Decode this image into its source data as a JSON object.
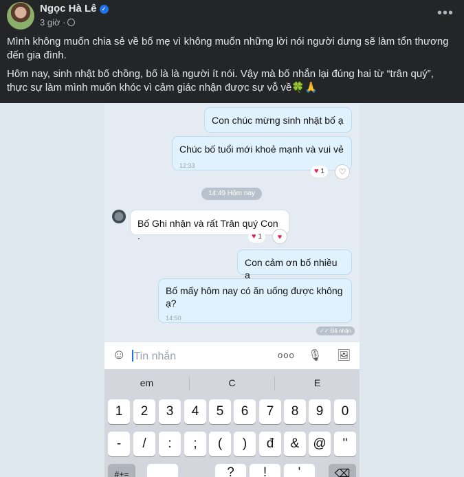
{
  "post": {
    "author": "Ngọc Hà Lê",
    "verified_glyph": "✓",
    "time": "3 giờ ·",
    "more_label": "•••",
    "paragraphs": [
      "Mình không muốn chia sẻ về bố mẹ vì không muốn những lời nói người dưng sẽ làm tổn thương đến gia đình.",
      "Hôm nay, sinh nhật bố chồng, bố là là người ít nói. Vậy mà bố nhắn lại đúng hai từ “trân quý”, thực sự làm mình muốn khóc vì cảm giác nhận được sự vỗ về🍀🙏"
    ]
  },
  "chat": {
    "messages": [
      {
        "text": "Con chúc mừng sinh nhật bố ạ",
        "direction": "out"
      },
      {
        "text": "Chúc bố tuổi mới khoẻ mạnh và vui vẻ",
        "time": "12:33",
        "direction": "out",
        "reaction_count": "1"
      },
      {
        "text": "Bố Ghi nhận và rất Trân quý Con .",
        "direction": "in",
        "reaction_count": "1"
      },
      {
        "text": "Con cảm ơn bố nhiều ạ",
        "direction": "out"
      },
      {
        "text": "Bố mấy hôm nay có ăn uống được không ạ?",
        "time": "14:50",
        "direction": "out"
      }
    ],
    "date_divider": "14:49 Hôm nay",
    "seen_label": "✓✓ Đã nhận",
    "heart_glyph": "♥",
    "heart_outline_glyph": "♡"
  },
  "input": {
    "placeholder": "Tin nhắn",
    "sticker_icon": "☺",
    "more_icon": "ooo",
    "mic_icon": "🎙",
    "image_icon": "🖼"
  },
  "keyboard": {
    "suggestions": [
      "em",
      "C",
      "E"
    ],
    "row1": [
      "1",
      "2",
      "3",
      "4",
      "5",
      "6",
      "7",
      "8",
      "9",
      "0"
    ],
    "row2": [
      "-",
      "/",
      ":",
      ";",
      "(",
      ")",
      "đ",
      "&",
      "@",
      "\""
    ],
    "row3": [
      "#+=",
      "",
      "?",
      "!",
      "'",
      "⌫"
    ]
  },
  "colors": {
    "facebook_bg": "#242526",
    "bubble_out": "#dff2fd",
    "bubble_in": "#ffffff",
    "accent": "#1b74e4",
    "heart": "#e0245e"
  }
}
